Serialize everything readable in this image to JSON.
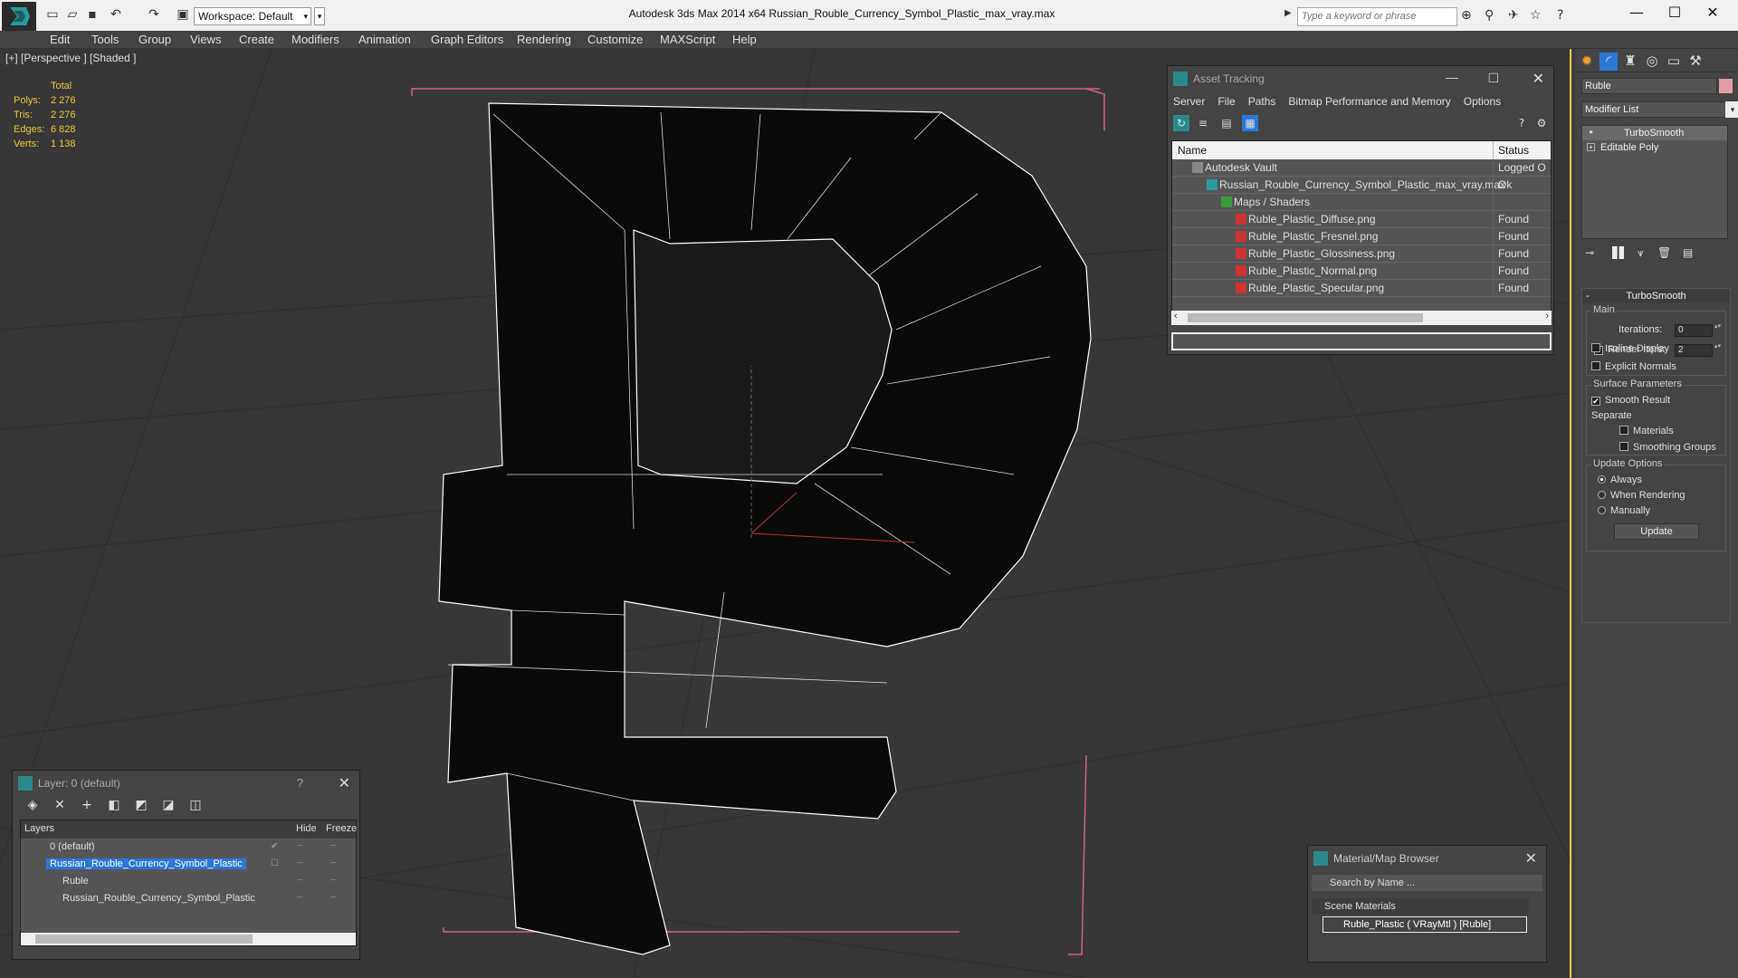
{
  "app": {
    "title": "Autodesk 3ds Max  2014 x64     Russian_Rouble_Currency_Symbol_Plastic_max_vray.max",
    "workspace": "Workspace: Default",
    "search_placeholder": "Type a keyword or phrase"
  },
  "menu": [
    "Edit",
    "Tools",
    "Group",
    "Views",
    "Create",
    "Modifiers",
    "Animation",
    "Graph Editors",
    "Rendering",
    "Customize",
    "MAXScript",
    "Help"
  ],
  "viewport": {
    "label": "[+] [Perspective ] [Shaded ]",
    "stats": {
      "header": "Total",
      "rows": [
        {
          "k": "Polys:",
          "v": "2 276"
        },
        {
          "k": "Tris:",
          "v": "2 276"
        },
        {
          "k": "Edges:",
          "v": "6 828"
        },
        {
          "k": "Verts:",
          "v": "1 138"
        }
      ]
    }
  },
  "asset_tracking": {
    "title": "Asset Tracking",
    "menu": [
      "Server",
      "File",
      "Paths",
      "Bitmap Performance and Memory",
      "Options"
    ],
    "col_name": "Name",
    "col_status": "Status",
    "rows": [
      {
        "name": "Autodesk Vault",
        "status": "Logged O"
      },
      {
        "name": "Russian_Rouble_Currency_Symbol_Plastic_max_vray.max",
        "status": "Ok"
      },
      {
        "name": "Maps / Shaders",
        "status": ""
      },
      {
        "name": "Ruble_Plastic_Diffuse.png",
        "status": "Found"
      },
      {
        "name": "Ruble_Plastic_Fresnel.png",
        "status": "Found"
      },
      {
        "name": "Ruble_Plastic_Glossiness.png",
        "status": "Found"
      },
      {
        "name": "Ruble_Plastic_Normal.png",
        "status": "Found"
      },
      {
        "name": "Ruble_Plastic_Specular.png",
        "status": "Found"
      }
    ]
  },
  "layer_panel": {
    "title": "Layer: 0 (default)",
    "help": "?",
    "col_layers": "Layers",
    "col_hide": "Hide",
    "col_freeze": "Freeze",
    "rows": [
      {
        "name": "0 (default)"
      },
      {
        "name": "Russian_Rouble_Currency_Symbol_Plastic"
      },
      {
        "name": "Ruble"
      },
      {
        "name": "Russian_Rouble_Currency_Symbol_Plastic"
      }
    ]
  },
  "material_browser": {
    "title": "Material/Map Browser",
    "search": "Search by Name ...",
    "category": "Scene Materials",
    "item": "Ruble_Plastic ( VRayMtl ) [Ruble]"
  },
  "command_panel": {
    "object_name": "Ruble",
    "object_color": "#e09ca4",
    "modifier_list": "Modifier List",
    "stack": [
      "TurboSmooth",
      "Editable Poly"
    ],
    "rollout_title": "TurboSmooth",
    "main_label": "Main",
    "iterations_label": "Iterations:",
    "iterations_value": "0",
    "render_iters_label": "Render Iters:",
    "render_iters_value": "2",
    "isoline_label": "Isoline Display",
    "explicit_label": "Explicit Normals",
    "surface_label": "Surface Parameters",
    "smooth_result_label": "Smooth Result",
    "separate_label": "Separate",
    "materials_label": "Materials",
    "smoothing_groups_label": "Smoothing Groups",
    "update_options_label": "Update Options",
    "always_label": "Always",
    "when_rendering_label": "When Rendering",
    "manually_label": "Manually",
    "update_button": "Update"
  }
}
